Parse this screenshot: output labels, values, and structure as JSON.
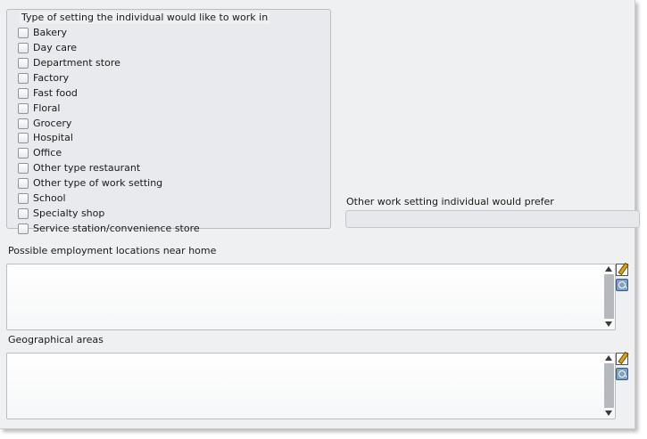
{
  "setting_group": {
    "title": "Type of setting the individual would like to work in",
    "options": [
      {
        "label": "Bakery",
        "checked": false
      },
      {
        "label": "Day care",
        "checked": false
      },
      {
        "label": "Department store",
        "checked": false
      },
      {
        "label": "Factory",
        "checked": false
      },
      {
        "label": "Fast food",
        "checked": false
      },
      {
        "label": "Floral",
        "checked": false
      },
      {
        "label": "Grocery",
        "checked": false
      },
      {
        "label": "Hospital",
        "checked": false
      },
      {
        "label": "Office",
        "checked": false
      },
      {
        "label": "Other type restaurant",
        "checked": false
      },
      {
        "label": "Other type of work setting",
        "checked": false
      },
      {
        "label": "School",
        "checked": false
      },
      {
        "label": "Specialty shop",
        "checked": false
      },
      {
        "label": "Service station/convenience store",
        "checked": false
      }
    ]
  },
  "other_setting": {
    "label": "Other work setting individual would prefer",
    "value": ""
  },
  "locations": {
    "label": "Possible employment locations near home",
    "value": ""
  },
  "areas": {
    "label": "Geographical areas",
    "value": ""
  },
  "icons": {
    "edit": "edit-pencil-icon",
    "zoom": "zoom-icon"
  }
}
